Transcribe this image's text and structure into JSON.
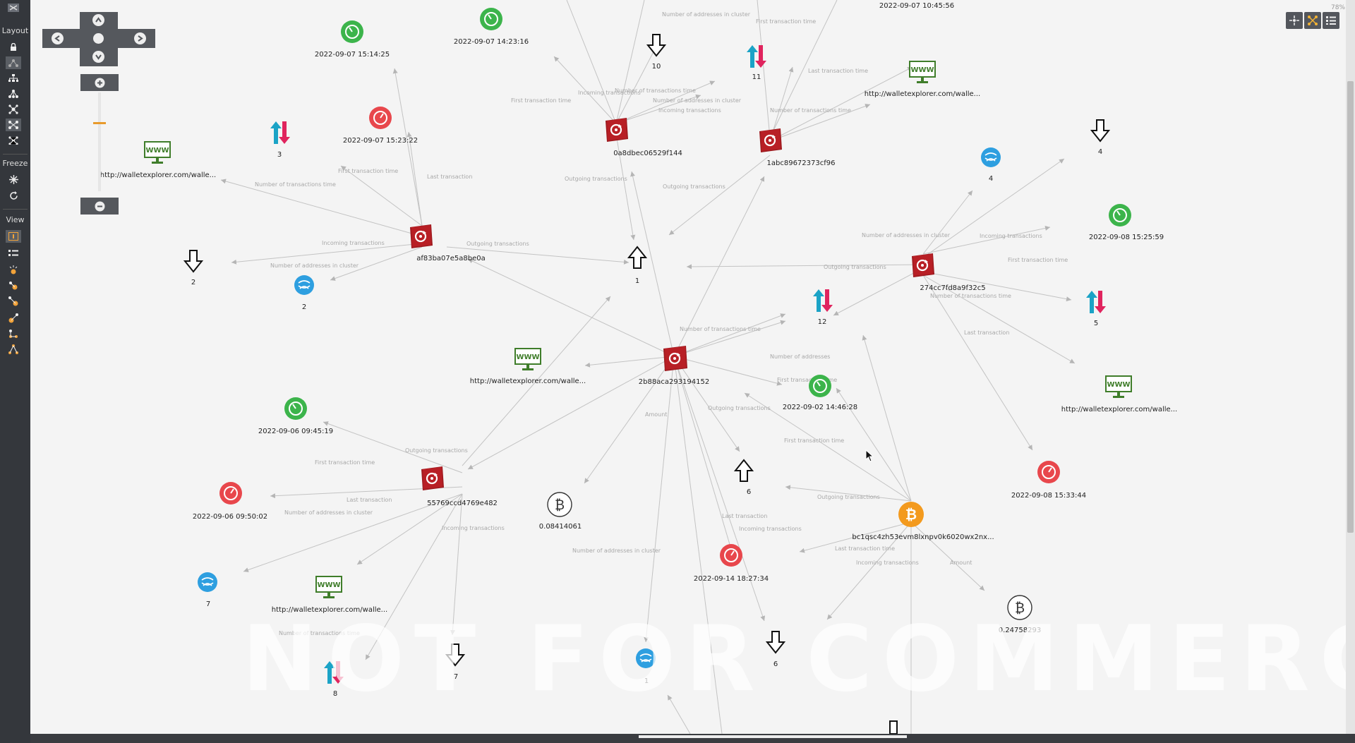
{
  "toolbar": {
    "layout_label": "Layout",
    "freeze_label": "Freeze",
    "view_label": "View"
  },
  "canvas": {
    "zoom_percent": "78%",
    "watermark": "NOT FOR COMMERCIAL USE"
  },
  "colors": {
    "cluster_red": "#9e1a1f",
    "clock_green": "#3cb44b",
    "clock_red": "#e8474c",
    "flow_blue": "#2e9fe0",
    "www_green": "#3f7d2a",
    "bitcoin_orange": "#f39a1e",
    "edge_gray": "#bdbdbd"
  },
  "nodes": {
    "c_2b88": {
      "label": "2b88aca293194152",
      "icon": "cluster-icon"
    },
    "c_0a8d": {
      "label": "0a8dbec06529f144",
      "icon": "cluster-icon"
    },
    "c_1abc": {
      "label": "1abc89672373cf96",
      "icon": "cluster-icon"
    },
    "c_af83": {
      "label": "af83ba07e5a8be0a",
      "icon": "cluster-icon"
    },
    "c_274c": {
      "label": "274cc7fd8a9f32c5",
      "icon": "cluster-icon"
    },
    "c_5576": {
      "label": "55769ccd4769e482",
      "icon": "cluster-icon"
    },
    "btc_addr": {
      "label": "bc1qsc4zh53evm8lxnpv0k6020wx2nx...",
      "icon": "bitcoin-icon"
    },
    "amt_1": {
      "label": "0.08414061",
      "icon": "bitcoin-outline-icon"
    },
    "amt_2": {
      "label": "0.24758293",
      "icon": "bitcoin-outline-icon"
    },
    "t1": {
      "label": "2022-09-07 15:14:25",
      "icon": "clock-first-icon"
    },
    "t2": {
      "label": "2022-09-07 14:23:16",
      "icon": "clock-first-icon"
    },
    "t3": {
      "label": "2022-09-07 10:45:56"
    },
    "t4": {
      "label": "2022-09-07 15:23:22",
      "icon": "clock-last-icon"
    },
    "t5": {
      "label": "2022-09-08 15:25:59",
      "icon": "clock-first-icon"
    },
    "t6": {
      "label": "2022-09-02 14:46:28",
      "icon": "clock-first-icon"
    },
    "t7": {
      "label": "2022-09-06 09:45:19",
      "icon": "clock-first-icon"
    },
    "t8": {
      "label": "2022-09-06 09:50:02",
      "icon": "clock-last-icon"
    },
    "t9": {
      "label": "2022-09-08 15:33:44",
      "icon": "clock-last-icon"
    },
    "t10": {
      "label": "2022-09-14 18:27:34",
      "icon": "clock-last-icon"
    },
    "w1": {
      "label": "http://walletexplorer.com/walle...",
      "icon": "www-icon"
    },
    "w2": {
      "label": "http://walletexplorer.com/walle...",
      "icon": "www-icon"
    },
    "w3": {
      "label": "http://walletexplorer.com/walle...",
      "icon": "www-icon"
    },
    "w4": {
      "label": "http://walletexplorer.com/walle...",
      "icon": "www-icon"
    },
    "w5": {
      "label": "http://walletexplorer.com/walle...",
      "icon": "www-icon"
    },
    "in_10": {
      "label": "10",
      "icon": "arrow-down-icon"
    },
    "in_4": {
      "label": "4",
      "icon": "arrow-down-icon"
    },
    "in_2": {
      "label": "2",
      "icon": "arrow-down-icon"
    },
    "in_7": {
      "label": "7",
      "icon": "arrow-down-icon"
    },
    "in_6": {
      "label": "6",
      "icon": "arrow-down-icon"
    },
    "out_1": {
      "label": "1",
      "icon": "arrow-up-icon"
    },
    "out_6": {
      "label": "6",
      "icon": "arrow-up-icon"
    },
    "tx_11": {
      "label": "11",
      "icon": "transactions-icon"
    },
    "tx_3": {
      "label": "3",
      "icon": "transactions-icon"
    },
    "tx_12": {
      "label": "12",
      "icon": "transactions-icon"
    },
    "tx_5": {
      "label": "5",
      "icon": "transactions-icon"
    },
    "tx_8": {
      "label": "8",
      "icon": "transactions-icon"
    },
    "addr_4": {
      "label": "4",
      "icon": "addresses-icon"
    },
    "addr_2": {
      "label": "2",
      "icon": "addresses-icon"
    },
    "addr_7": {
      "label": "7",
      "icon": "addresses-icon"
    },
    "addr_1": {
      "label": "1",
      "icon": "addresses-icon"
    }
  },
  "edge_labels": [
    "Number of addresses in cluster",
    "First transaction time",
    "Incoming transactions",
    "Number of transactions time",
    "Number of addresses in cluster",
    "Incoming transactions",
    "Last transaction time",
    "Number of transactions time",
    "First transaction time",
    "Outgoing transactions",
    "Outgoing transactions",
    "First transaction time",
    "Last transaction",
    "Number of transactions time",
    "Incoming transactions",
    "Number of addresses in cluster",
    "Outgoing transactions",
    "Number of addresses in cluster",
    "Incoming transactions",
    "First transaction time",
    "Outgoing transactions",
    "Number of transactions time",
    "Last transaction",
    "Number of transactions time",
    "Number of addresses",
    "First transaction time",
    "Outgoing transactions",
    "Amount",
    "First transaction time",
    "Outgoing transactions",
    "First transaction time",
    "Last transaction",
    "Number of addresses in cluster",
    "Incoming transactions",
    "Number of transactions time",
    "Outgoing transactions",
    "Last transaction",
    "Incoming transactions",
    "Last transaction time",
    "Incoming transactions",
    "Amount",
    "Number of addresses in cluster"
  ]
}
